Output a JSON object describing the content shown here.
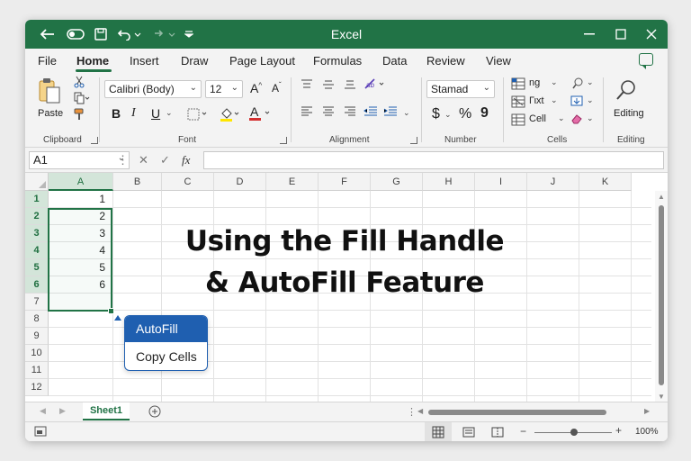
{
  "titlebar": {
    "title": "Excel",
    "autosave_icon": "autosave-toggle-icon",
    "save_icon": "save-icon",
    "undo_icon": "undo-icon",
    "redo_icon": "redo-icon"
  },
  "menu": {
    "tabs": [
      "File",
      "Home",
      "Insert",
      "Draw",
      "Page Layout",
      "Formulas",
      "Data",
      "Review",
      "View"
    ],
    "active": "Home"
  },
  "ribbon": {
    "clipboard": {
      "paste_label": "Paste",
      "group_label": "Clipboard"
    },
    "font": {
      "font_name": "Calibri (Body)",
      "font_size": "12",
      "grow_label": "A^",
      "shrink_label": "A˅",
      "bold": "B",
      "italic": "I",
      "underline": "U",
      "group_label": "Font"
    },
    "alignment": {
      "group_label": "Alignment"
    },
    "number": {
      "format": "Stamad",
      "currency": "$",
      "percent": "%",
      "comma": "9",
      "group_label": "Number"
    },
    "cells": {
      "insert_label": "ng",
      "delete_label": "Γιxt",
      "format_label": "Cell",
      "group_label": "Cells"
    },
    "editing": {
      "label": "Editing",
      "group_label": "Editing"
    }
  },
  "formula_bar": {
    "name_box": "A1",
    "fx_label": "fx",
    "value": ""
  },
  "grid": {
    "columns": [
      "A",
      "B",
      "C",
      "D",
      "E",
      "F",
      "G",
      "H",
      "I",
      "J",
      "K"
    ],
    "rows": [
      "1",
      "2",
      "3",
      "4",
      "5",
      "6",
      "7",
      "8",
      "9",
      "10",
      "11",
      "12"
    ],
    "selected_column": "A",
    "column_a_values": [
      "1",
      "2",
      "3",
      "4",
      "5",
      "6"
    ]
  },
  "overlay": {
    "line1": "Using the Fill Handle",
    "line2": "& AutoFill Feature"
  },
  "autofill_menu": {
    "options": [
      "AutoFill",
      "Copy Cells"
    ],
    "highlighted": "AutoFill"
  },
  "sheets": {
    "tabs": [
      "Sheet1"
    ],
    "active": "Sheet1"
  },
  "status": {
    "zoom": "100%"
  },
  "colors": {
    "accent": "#217346",
    "highlight": "#1f5fb0"
  }
}
